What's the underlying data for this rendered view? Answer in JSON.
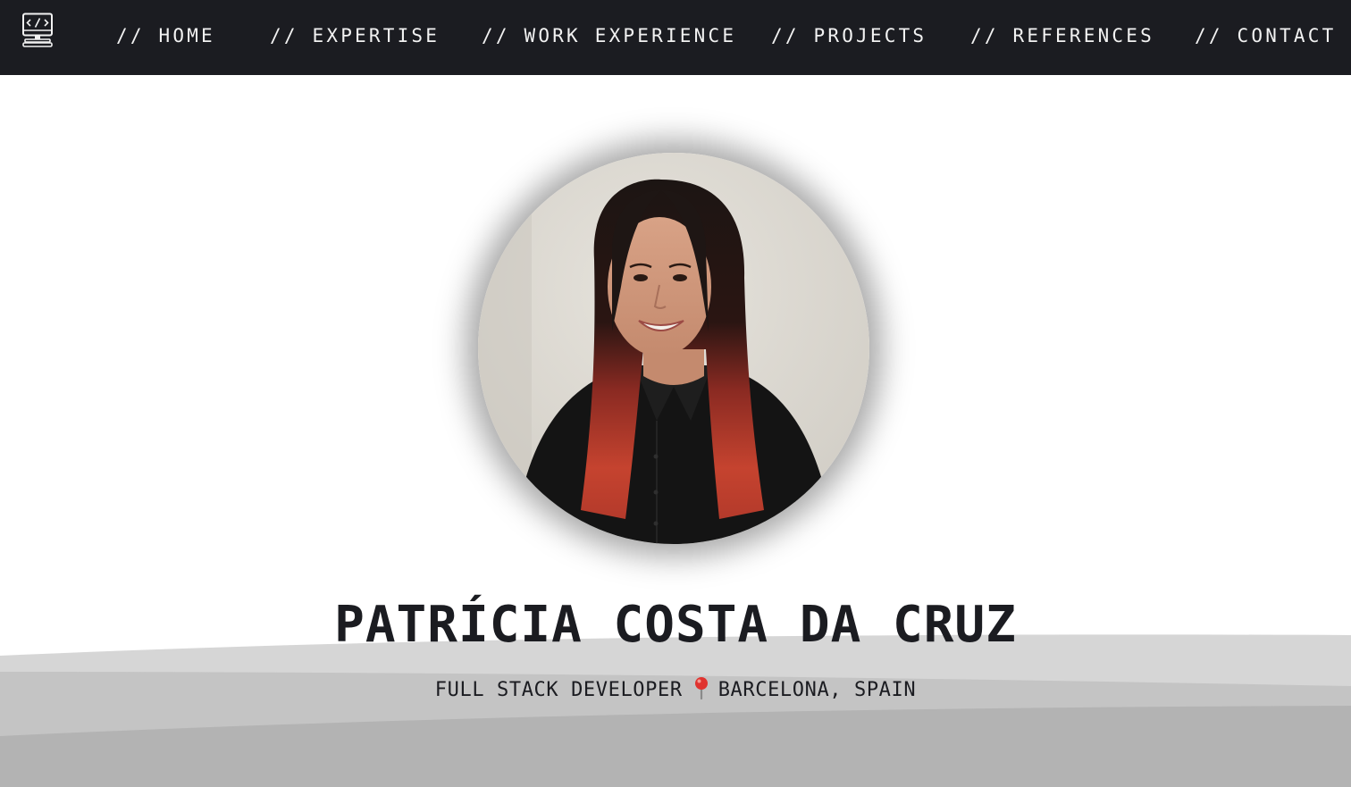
{
  "nav": {
    "logo_icon": "computer-code-icon",
    "items": [
      {
        "label": "// HOME"
      },
      {
        "label": "// EXPERTISE"
      },
      {
        "label": "// WORK EXPERIENCE"
      },
      {
        "label": "// PROJECTS"
      },
      {
        "label": "// REFERENCES"
      },
      {
        "label": "// CONTACT"
      }
    ]
  },
  "hero": {
    "name": "PATRÍCIA COSTA DA CRUZ",
    "role": "FULL STACK DEVELOPER",
    "location_icon": "map-pin-icon",
    "location": "BARCELONA, SPAIN"
  },
  "colors": {
    "nav_background": "#1b1c21",
    "nav_text": "#f2f2f2",
    "text_dark": "#1b1c21",
    "wave_light": "#d6d6d6",
    "wave_mid": "#c4c4c4",
    "wave_dark": "#b3b3b3",
    "pin_red": "#e0332f"
  }
}
